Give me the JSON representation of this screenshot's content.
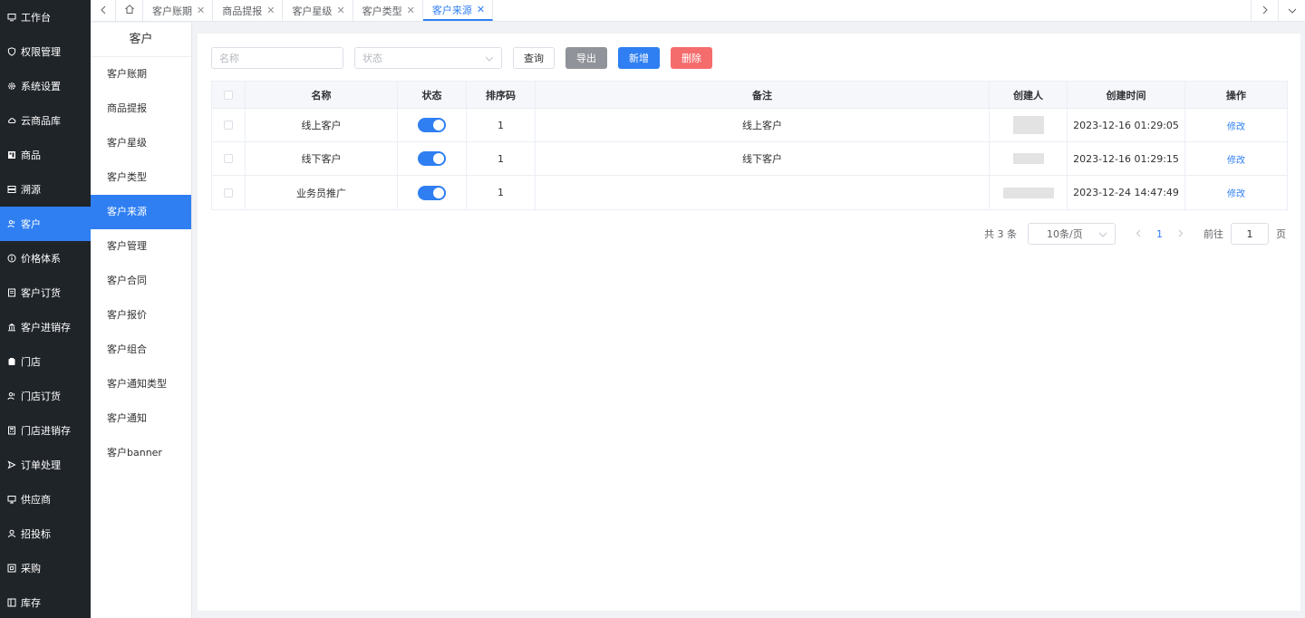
{
  "sidebar": {
    "items": [
      {
        "label": "工作台",
        "icon": "monitor-icon"
      },
      {
        "label": "权限管理",
        "icon": "shield-icon"
      },
      {
        "label": "系统设置",
        "icon": "gear-icon"
      },
      {
        "label": "云商品库",
        "icon": "cloud-icon"
      },
      {
        "label": "商品",
        "icon": "grid-icon"
      },
      {
        "label": "溯源",
        "icon": "server-icon"
      },
      {
        "label": "客户",
        "icon": "users-icon"
      },
      {
        "label": "价格体系",
        "icon": "info-icon"
      },
      {
        "label": "客户订货",
        "icon": "document-icon"
      },
      {
        "label": "客户进销存",
        "icon": "bank-icon"
      },
      {
        "label": "门店",
        "icon": "store-icon"
      },
      {
        "label": "门店订货",
        "icon": "users-icon"
      },
      {
        "label": "门店进销存",
        "icon": "calculator-icon"
      },
      {
        "label": "订单处理",
        "icon": "send-icon"
      },
      {
        "label": "供应商",
        "icon": "display-icon"
      },
      {
        "label": "招投标",
        "icon": "user-icon"
      },
      {
        "label": "采购",
        "icon": "box-icon"
      },
      {
        "label": "库存",
        "icon": "panel-icon"
      }
    ],
    "active_index": 6
  },
  "tabs": [
    {
      "label": "客户账期"
    },
    {
      "label": "商品提报"
    },
    {
      "label": "客户星级"
    },
    {
      "label": "客户类型"
    },
    {
      "label": "客户来源",
      "active": true
    }
  ],
  "submenu": {
    "title": "客户",
    "items": [
      "客户账期",
      "商品提报",
      "客户星级",
      "客户类型",
      "客户来源",
      "客户管理",
      "客户合同",
      "客户报价",
      "客户组合",
      "客户通知类型",
      "客户通知",
      "客户banner"
    ],
    "active_index": 4
  },
  "toolbar": {
    "name_placeholder": "名称",
    "status_placeholder": "状态",
    "query_label": "查询",
    "export_label": "导出",
    "add_label": "新增",
    "delete_label": "删除"
  },
  "table": {
    "headers": {
      "name": "名称",
      "status": "状态",
      "sort": "排序码",
      "remark": "备注",
      "creator": "创建人",
      "created": "创建时间",
      "action": "操作"
    },
    "rows": [
      {
        "name": "线上客户",
        "status": true,
        "sort": "1",
        "remark": "线上客户",
        "created": "2023-12-16 01:29:05",
        "action": "修改"
      },
      {
        "name": "线下客户",
        "status": true,
        "sort": "1",
        "remark": "线下客户",
        "created": "2023-12-16 01:29:15",
        "action": "修改"
      },
      {
        "name": "业务员推广",
        "status": true,
        "sort": "1",
        "remark": "",
        "created": "2023-12-24 14:47:49",
        "action": "修改"
      }
    ]
  },
  "pagination": {
    "total_text": "共 3 条",
    "page_size": "10条/页",
    "current_page": "1",
    "goto_label": "前往",
    "goto_value": "1",
    "page_unit": "页"
  },
  "colors": {
    "accent": "#2f7ff2",
    "sidebar_bg": "#1f2429",
    "danger": "#f56c6c",
    "muted": "#909399"
  }
}
